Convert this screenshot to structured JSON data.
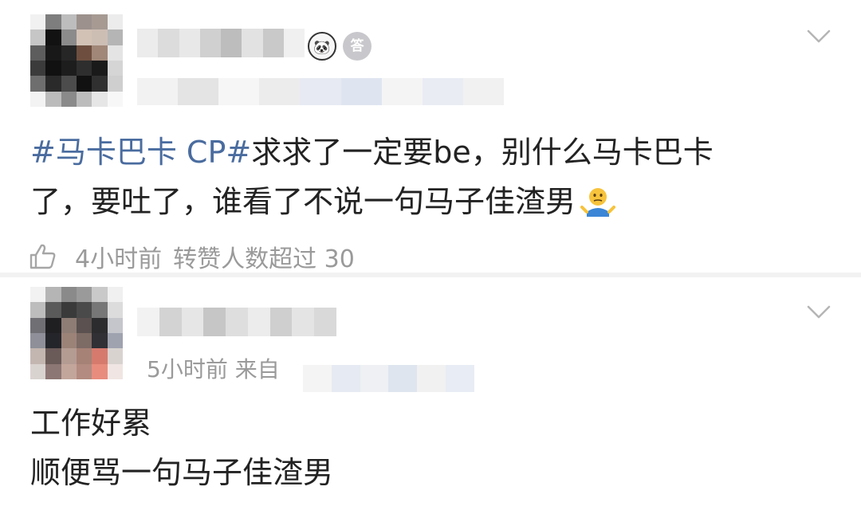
{
  "comments": [
    {
      "topic": "#马卡巴卡 CP#",
      "text_line1": "求求了一定要be，别什么马卡巴卡",
      "text_line2": "了，要吐了，谁看了不说一句马子佳渣男",
      "emoji": "shrugging-person-icon",
      "time": "4小时前",
      "status": "转赞人数超过 30",
      "badges": [
        "panda-icon",
        "medal-icon"
      ],
      "medal_glyph": "答"
    },
    {
      "meta": "5小时前 来自",
      "line1": "工作好累",
      "line2": "顺便骂一句马子佳渣男"
    }
  ],
  "colors": {
    "topic_link": "#4a6c9f",
    "meta_text": "#9a9a9a",
    "divider": "#f2f2f2"
  }
}
